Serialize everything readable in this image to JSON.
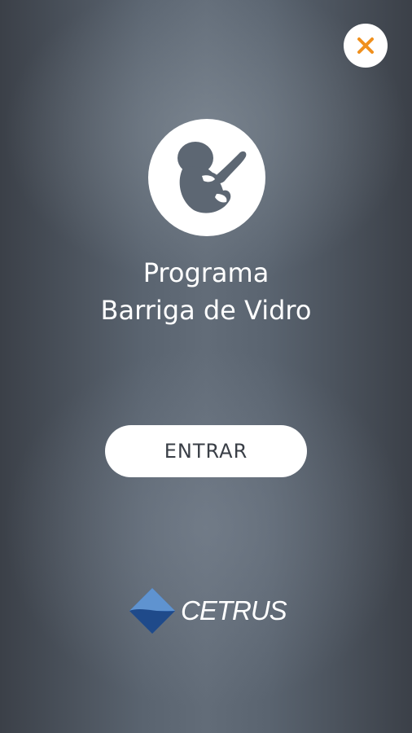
{
  "header": {
    "close_icon": "close-icon",
    "close_icon_color": "#f0901e"
  },
  "hero": {
    "icon": "fetus-icon",
    "title_line1": "Programa",
    "title_line2": "Barriga de Vidro"
  },
  "actions": {
    "enter_label": "ENTRAR"
  },
  "footer": {
    "logo_icon": "cetrus-diamond-icon",
    "logo_text": "CETRUS",
    "logo_color": "#2b5fa8"
  }
}
